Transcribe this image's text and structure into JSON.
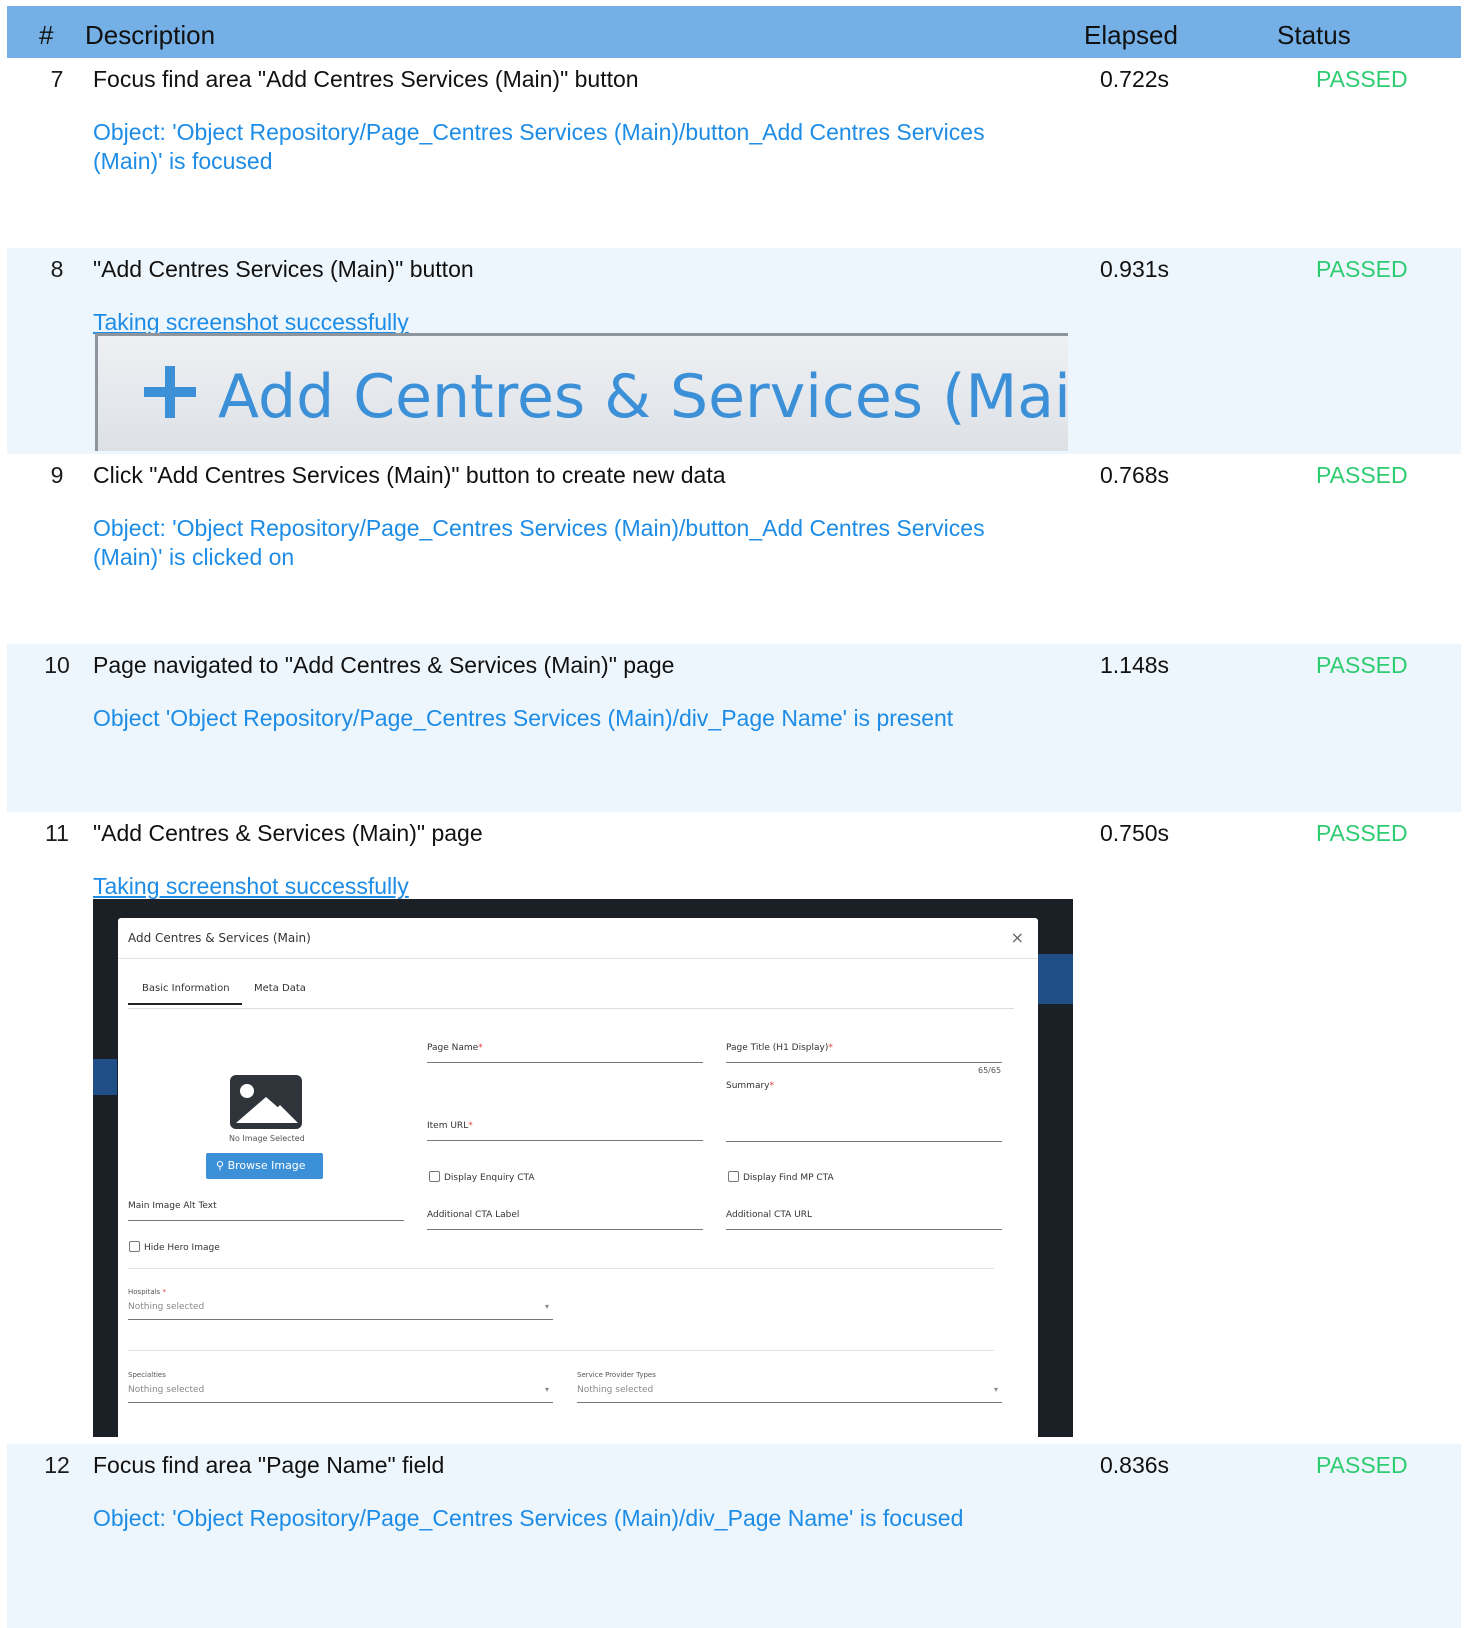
{
  "header": {
    "num": "#",
    "description": "Description",
    "elapsed": "Elapsed",
    "status": "Status"
  },
  "steps": [
    {
      "num": "7",
      "desc": "Focus find area \"Add Centres  Services (Main)\" button",
      "elapsed": "0.722s",
      "status": "PASSED",
      "msg": "Object: 'Object Repository/Page_Centres  Services (Main)/button_Add Centres  Services (Main)' is focused"
    },
    {
      "num": "8",
      "desc": "\"Add Centres  Services (Main)\" button",
      "elapsed": "0.931s",
      "status": "PASSED",
      "msg": "Taking screenshot successfully"
    },
    {
      "num": "9",
      "desc": "Click \"Add Centres  Services (Main)\" button to create new data",
      "elapsed": "0.768s",
      "status": "PASSED",
      "msg": "Object: 'Object Repository/Page_Centres  Services (Main)/button_Add Centres  Services (Main)' is clicked on"
    },
    {
      "num": "10",
      "desc": "Page navigated to \"Add Centres & Services (Main)\" page",
      "elapsed": "1.148s",
      "status": "PASSED",
      "msg": "Object 'Object Repository/Page_Centres  Services (Main)/div_Page Name' is present"
    },
    {
      "num": "11",
      "desc": "\"Add Centres & Services (Main)\" page",
      "elapsed": "0.750s",
      "status": "PASSED",
      "msg": "Taking screenshot successfully"
    },
    {
      "num": "12",
      "desc": "Focus find area \"Page Name\" field",
      "elapsed": "0.836s",
      "status": "PASSED",
      "msg": "Object: 'Object Repository/Page_Centres  Services (Main)/div_Page Name' is focused"
    }
  ],
  "shot1": {
    "label": "Add Centres & Services (Main)"
  },
  "modal": {
    "title": "Add Centres & Services (Main)",
    "close": "×",
    "tab_basic": "Basic Information",
    "tab_meta": "Meta Data",
    "page_name": "Page Name",
    "page_title": "Page Title (H1 Display)",
    "counter": "65/65",
    "summary": "Summary",
    "item_url": "Item URL",
    "no_image": "No Image Selected",
    "browse": "Browse Image",
    "display_enquiry": "Display Enquiry CTA",
    "display_find_mp": "Display Find MP CTA",
    "main_alt": "Main Image Alt Text",
    "additional_label": "Additional CTA Label",
    "additional_url": "Additional CTA URL",
    "hide_hero": "Hide Hero Image",
    "hospitals": "Hospitals",
    "nothing_selected": "Nothing selected",
    "specialties": "Specialties",
    "service_provider": "Service Provider Types",
    "required_mark": "*"
  },
  "colors": {
    "header_bg": "#74b0e6",
    "passed": "#2ecc71",
    "message": "#1d8ce6",
    "alt_row": "#eef6fd"
  }
}
